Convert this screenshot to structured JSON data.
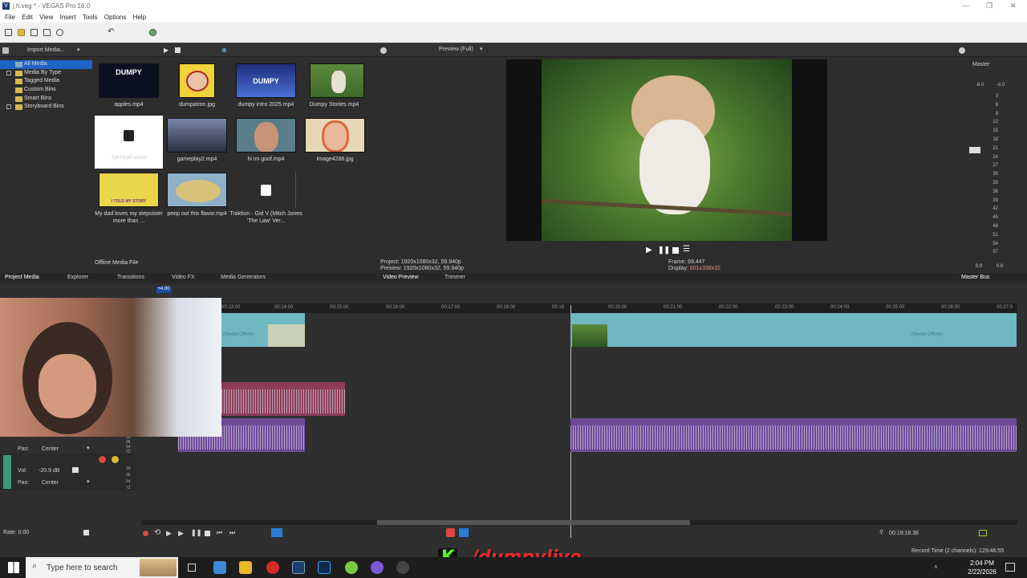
{
  "window": {
    "title": "j h.veg * - VEGAS Pro 16.0",
    "logo": "V"
  },
  "menu": [
    "File",
    "Edit",
    "View",
    "Insert",
    "Tools",
    "Options",
    "Help"
  ],
  "media_panel": {
    "import_label": "Import Media...",
    "tree": [
      "All Media",
      "Media By Type",
      "Tagged Media",
      "Custom Bins",
      "Smart Bins",
      "Storyboard Bins"
    ],
    "items": [
      {
        "name": "apples.mp4",
        "thumb_text": "DUMPY"
      },
      {
        "name": "dumpatron.jpg"
      },
      {
        "name": "dumpy intro 2025.mp4",
        "thumb_text": "DUMPY"
      },
      {
        "name": "Dumpy Stories.mp4"
      },
      {
        "name": "",
        "faint_text": "Tyb49ig4f.webm"
      },
      {
        "name": "gameplay2.mp4"
      },
      {
        "name": "hi im goof.mp4"
      },
      {
        "name": "Image4286.jpg"
      },
      {
        "name": "My dad loves my stepsister more than ...",
        "thumb_text": "I TOLD MY STORY"
      },
      {
        "name": "peep out this flavor.mp4"
      },
      {
        "name": "Traktion - Gid V (Mitch Jones 'The Law' Ver..."
      }
    ],
    "status": "Offline Media File",
    "tabs": [
      "Project Media",
      "Explorer",
      "Transitions",
      "Video FX",
      "Media Generators"
    ]
  },
  "preview": {
    "quality": "Preview (Full)",
    "project": "1920x1080x32, 59.940p",
    "preview_res": "1920x1080x32, 59.940p",
    "frame": "69,447",
    "display": "601x338x32",
    "labels": {
      "project": "Project:",
      "preview": "Preview:",
      "frame": "Frame:",
      "display": "Display:"
    },
    "tabs": [
      "Video Preview",
      "Trimmer"
    ]
  },
  "master": {
    "title": "Master",
    "left_db": "-8.0",
    "right_db": "-8.0",
    "scale": [
      "3",
      "6",
      "9",
      "12",
      "15",
      "18",
      "21",
      "24",
      "27",
      "30",
      "33",
      "36",
      "39",
      "42",
      "45",
      "48",
      "51",
      "54",
      "57"
    ],
    "bottom_left": "0.0",
    "bottom_right": "0.0",
    "tab": "Master Bus"
  },
  "timeline": {
    "cursor_badge": "+4.00",
    "ticks": [
      "00:13:00",
      "00:14:00",
      "00:15:00",
      "00:16:00",
      "00:17:00",
      "00:18:00",
      "00:19",
      "00:20:00",
      "00:21:00",
      "00:22:00",
      "00:23:00",
      "00:24:00",
      "00:25:00",
      "00:26:00",
      "00:27:0"
    ],
    "media_offline": "(Media Offline)",
    "track1": {
      "vol_label": "Vol:",
      "pan_label": "Pan:",
      "pan": "Center",
      "db_scale": [
        "18",
        "36",
        "54",
        "72"
      ]
    },
    "track2": {
      "vol_label": "Vol:",
      "vol": "-20.9 dB",
      "pan_label": "Pan:",
      "pan": "Center",
      "db_scale": [
        "18",
        "36",
        "54",
        "72"
      ]
    },
    "rate": "Rate: 0.00",
    "time": "00:19:18.36",
    "record_time": "Record Time (2 channels): 129:46:55"
  },
  "overlay": {
    "handle": "/dumpylive",
    "logo_letter": "K"
  },
  "taskbar": {
    "search": "Type here to search",
    "time": "2:04 PM",
    "date": "2/22/2026"
  },
  "colors": {
    "video_clip": "#6fb7c1",
    "audio_red": "#8a3e58",
    "audio_purple": "#6c4a98",
    "kick_green": "#53fc18"
  }
}
